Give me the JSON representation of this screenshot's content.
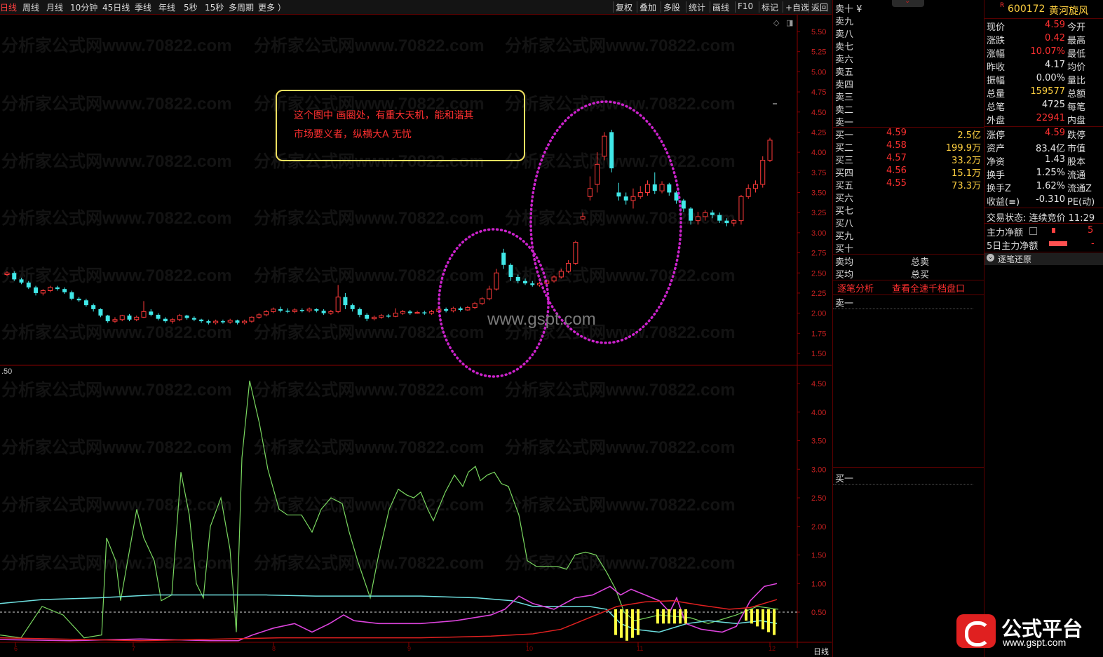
{
  "toolbar": {
    "periods": [
      "日线",
      "周线",
      "月线",
      "10分钟",
      "45日线",
      "季线",
      "年线",
      "5秒",
      "15秒",
      "多周期",
      "更多 ）"
    ],
    "tools": [
      "复权",
      "叠加",
      "多股",
      "统计",
      "画线",
      "F10",
      "标记",
      "+自选",
      "返回"
    ]
  },
  "main_axis": [
    "5.50",
    "5.25",
    "5.00",
    "4.75",
    "4.50",
    "4.25",
    "4.00",
    "3.75",
    "3.50",
    "3.25",
    "3.00",
    "2.75",
    "2.50",
    "2.25",
    "2.00",
    "1.75",
    "1.50"
  ],
  "sub_axis": [
    "4.50",
    "4.00",
    "3.50",
    "3.00",
    "2.50",
    "2.00",
    "1.50",
    "1.00",
    "0.50"
  ],
  "sub_left_label": ".50",
  "date_marks": [
    "6",
    "7",
    "8",
    "9",
    "10",
    "11",
    "12"
  ],
  "bottom_label": "日线",
  "annotation": {
    "line1": "这个图中 画圈处，有重大天机，能和谐其",
    "line2": "市场要义者，纵横大A 无忧"
  },
  "center_watermark": "www.gspt.com",
  "watermark_text": "分析家公式网www.70822.com",
  "colors": {
    "up": "#ff3a3a",
    "down": "#40e8e8",
    "frame": "#8a0000",
    "circle": "#cc22cc"
  },
  "chart_data": {
    "type": "candlestick",
    "ylim": [
      1.4,
      5.6
    ],
    "candles": [
      [
        2.48,
        2.5,
        2.52,
        2.46
      ],
      [
        2.5,
        2.42,
        2.52,
        2.4
      ],
      [
        2.42,
        2.38,
        2.44,
        2.36
      ],
      [
        2.38,
        2.32,
        2.4,
        2.3
      ],
      [
        2.32,
        2.25,
        2.34,
        2.22
      ],
      [
        2.25,
        2.28,
        2.3,
        2.22
      ],
      [
        2.28,
        2.32,
        2.34,
        2.26
      ],
      [
        2.32,
        2.3,
        2.34,
        2.28
      ],
      [
        2.3,
        2.26,
        2.32,
        2.24
      ],
      [
        2.26,
        2.18,
        2.28,
        2.16
      ],
      [
        2.18,
        2.16,
        2.2,
        2.14
      ],
      [
        2.16,
        2.1,
        2.18,
        2.08
      ],
      [
        2.1,
        2.05,
        2.12,
        2.02
      ],
      [
        2.05,
        1.97,
        2.06,
        1.95
      ],
      [
        1.97,
        1.9,
        1.98,
        1.88
      ],
      [
        1.9,
        1.92,
        1.95,
        1.88
      ],
      [
        1.92,
        1.97,
        1.98,
        1.9
      ],
      [
        1.97,
        1.92,
        1.99,
        1.9
      ],
      [
        1.92,
        1.95,
        1.97,
        1.9
      ],
      [
        1.95,
        2.02,
        2.15,
        1.94
      ],
      [
        2.02,
        1.98,
        2.05,
        1.96
      ],
      [
        1.98,
        1.93,
        2.0,
        1.91
      ],
      [
        1.93,
        1.9,
        1.95,
        1.88
      ],
      [
        1.9,
        1.92,
        1.94,
        1.87
      ],
      [
        1.92,
        1.97,
        1.99,
        1.9
      ],
      [
        1.97,
        1.94,
        1.98,
        1.92
      ],
      [
        1.94,
        1.92,
        1.96,
        1.9
      ],
      [
        1.92,
        1.9,
        1.93,
        1.88
      ],
      [
        1.9,
        1.88,
        1.92,
        1.86
      ],
      [
        1.88,
        1.9,
        1.92,
        1.86
      ],
      [
        1.9,
        1.89,
        1.92,
        1.87
      ],
      [
        1.89,
        1.91,
        1.93,
        1.87
      ],
      [
        1.91,
        1.88,
        1.92,
        1.86
      ],
      [
        1.88,
        1.9,
        1.92,
        1.86
      ],
      [
        1.9,
        1.95,
        1.96,
        1.88
      ],
      [
        1.95,
        1.98,
        2.0,
        1.93
      ],
      [
        1.98,
        2.02,
        2.04,
        1.96
      ],
      [
        2.02,
        2.05,
        2.07,
        2.0
      ],
      [
        2.05,
        2.03,
        2.08,
        2.01
      ],
      [
        2.03,
        2.02,
        2.06,
        2.0
      ],
      [
        2.02,
        2.04,
        2.06,
        2.0
      ],
      [
        2.04,
        2.03,
        2.06,
        2.01
      ],
      [
        2.03,
        2.05,
        2.07,
        2.01
      ],
      [
        2.05,
        2.03,
        2.06,
        2.01
      ],
      [
        2.03,
        2.0,
        2.05,
        1.98
      ],
      [
        2.0,
        2.02,
        2.04,
        1.98
      ],
      [
        2.02,
        2.2,
        2.35,
        2.0
      ],
      [
        2.2,
        2.1,
        2.25,
        2.05
      ],
      [
        2.1,
        2.05,
        2.12,
        2.02
      ],
      [
        2.05,
        1.98,
        2.07,
        1.95
      ],
      [
        1.98,
        1.93,
        2.0,
        1.9
      ],
      [
        1.93,
        1.95,
        1.97,
        1.91
      ],
      [
        1.95,
        1.97,
        1.99,
        1.93
      ],
      [
        1.97,
        1.96,
        1.99,
        1.94
      ],
      [
        1.96,
        2.0,
        2.06,
        1.95
      ],
      [
        2.0,
        2.02,
        2.04,
        1.98
      ],
      [
        2.02,
        2.0,
        2.04,
        1.98
      ],
      [
        2.0,
        2.01,
        2.03,
        1.99
      ],
      [
        2.01,
        2.0,
        2.03,
        1.98
      ],
      [
        2.0,
        2.02,
        2.04,
        1.98
      ],
      [
        2.02,
        2.05,
        2.07,
        2.0
      ],
      [
        2.05,
        2.03,
        2.07,
        2.01
      ],
      [
        2.03,
        2.06,
        2.08,
        2.01
      ],
      [
        2.06,
        2.04,
        2.08,
        2.02
      ],
      [
        2.04,
        2.07,
        2.09,
        2.03
      ],
      [
        2.07,
        2.12,
        2.14,
        2.05
      ],
      [
        2.12,
        2.18,
        2.2,
        2.1
      ],
      [
        2.18,
        2.3,
        2.34,
        2.16
      ],
      [
        2.3,
        2.5,
        2.55,
        2.28
      ],
      [
        2.75,
        2.6,
        2.8,
        2.55
      ],
      [
        2.6,
        2.45,
        2.62,
        2.4
      ],
      [
        2.45,
        2.4,
        2.48,
        2.37
      ],
      [
        2.4,
        2.37,
        2.43,
        2.35
      ],
      [
        2.37,
        2.35,
        2.4,
        2.33
      ],
      [
        2.35,
        2.37,
        2.39,
        2.33
      ],
      [
        2.37,
        2.4,
        2.42,
        2.35
      ],
      [
        2.4,
        2.45,
        2.47,
        2.38
      ],
      [
        2.45,
        2.52,
        2.55,
        2.43
      ],
      [
        2.52,
        2.62,
        2.66,
        2.5
      ],
      [
        2.62,
        2.88,
        2.9,
        2.6
      ],
      [
        3.17,
        3.2,
        3.25,
        3.16
      ],
      [
        3.45,
        3.55,
        3.7,
        3.4
      ],
      [
        3.6,
        3.85,
        4.0,
        3.5
      ],
      [
        3.95,
        4.2,
        4.25,
        3.9
      ],
      [
        4.25,
        3.8,
        4.28,
        3.75
      ],
      [
        3.5,
        3.45,
        3.62,
        3.4
      ],
      [
        3.45,
        3.4,
        3.5,
        3.35
      ],
      [
        3.4,
        3.45,
        3.55,
        3.3
      ],
      [
        3.45,
        3.5,
        3.58,
        3.42
      ],
      [
        3.5,
        3.6,
        3.65,
        3.46
      ],
      [
        3.6,
        3.52,
        3.75,
        3.48
      ],
      [
        3.52,
        3.6,
        3.64,
        3.49
      ],
      [
        3.6,
        3.5,
        3.62,
        3.46
      ],
      [
        3.5,
        3.4,
        3.52,
        3.36
      ],
      [
        3.4,
        3.3,
        3.42,
        3.26
      ],
      [
        3.3,
        3.15,
        3.32,
        3.1
      ],
      [
        3.15,
        3.2,
        3.26,
        3.1
      ],
      [
        3.2,
        3.25,
        3.28,
        3.15
      ],
      [
        3.25,
        3.22,
        3.28,
        3.18
      ],
      [
        3.22,
        3.15,
        3.25,
        3.12
      ],
      [
        3.15,
        3.12,
        3.18,
        3.08
      ],
      [
        3.12,
        3.15,
        3.17,
        3.08
      ],
      [
        3.15,
        3.45,
        3.47,
        3.1
      ],
      [
        3.45,
        3.55,
        3.6,
        3.42
      ],
      [
        3.55,
        3.6,
        3.65,
        3.5
      ],
      [
        3.6,
        3.9,
        3.95,
        3.56
      ],
      [
        3.9,
        4.15,
        4.18,
        3.88
      ]
    ]
  },
  "order_book": {
    "sells": [
      "卖十 ¥",
      "卖九",
      "卖八",
      "卖七",
      "卖六",
      "卖五",
      "卖四",
      "卖三",
      "卖二",
      "卖一"
    ],
    "buys": [
      {
        "label": "买一",
        "price": "4.59",
        "vol": "2.5亿"
      },
      {
        "label": "买二",
        "price": "4.58",
        "vol": "199.9万"
      },
      {
        "label": "买三",
        "price": "4.57",
        "vol": "33.2万"
      },
      {
        "label": "买四",
        "price": "4.56",
        "vol": "15.1万"
      },
      {
        "label": "买五",
        "price": "4.55",
        "vol": "73.3万"
      },
      {
        "label": "买六",
        "price": "",
        "vol": ""
      },
      {
        "label": "买七",
        "price": "",
        "vol": ""
      },
      {
        "label": "买八",
        "price": "",
        "vol": ""
      },
      {
        "label": "买九",
        "price": "",
        "vol": ""
      },
      {
        "label": "买十",
        "price": "",
        "vol": ""
      }
    ],
    "sell_avg": "卖均",
    "sell_total": "总卖",
    "buy_avg": "买均",
    "buy_total": "总买",
    "link_tick": "逐笔分析",
    "link_full": "查看全速千档盘口",
    "sell1_label": "卖一",
    "buy1_label": "买一"
  },
  "stock": {
    "badge": "R",
    "code": "600172",
    "name": "黄河旋风",
    "quotes": [
      {
        "label": "现价",
        "value": "4.59",
        "cls": "red",
        "right": "今开"
      },
      {
        "label": "涨跌",
        "value": "0.42",
        "cls": "red",
        "right": "最高"
      },
      {
        "label": "涨幅",
        "value": "10.07%",
        "cls": "red",
        "right": "最低"
      },
      {
        "label": "昨收",
        "value": "4.17",
        "cls": "white",
        "right": "均价"
      },
      {
        "label": "振幅",
        "value": "0.00%",
        "cls": "white",
        "right": "量比"
      },
      {
        "label": "总量",
        "value": "159577",
        "cls": "gold",
        "right": "总额"
      },
      {
        "label": "总笔",
        "value": "4725",
        "cls": "white",
        "right": "每笔"
      },
      {
        "label": "外盘",
        "value": "22941",
        "cls": "red",
        "right": "内盘"
      },
      {
        "label": "涨停",
        "value": "4.59",
        "cls": "red",
        "right": "跌停"
      },
      {
        "label": "资产",
        "value": "83.4亿",
        "cls": "white",
        "right": "市值"
      },
      {
        "label": "净资",
        "value": "1.43",
        "cls": "white",
        "right": "股本"
      },
      {
        "label": "换手",
        "value": "1.25%",
        "cls": "white",
        "right": "流通"
      },
      {
        "label": "换手Z",
        "value": "1.62%",
        "cls": "white",
        "right": "流通Z"
      },
      {
        "label": "收益(≡)",
        "value": "-0.310",
        "cls": "white",
        "right": "PE(动)"
      }
    ],
    "status": "交易状态: 连续竞价 11:29",
    "main_flow_label": "主力净额",
    "main_flow_val": "5",
    "flow5_label": "5日主力净额",
    "flow5_val": "-",
    "restore": "逐笔还原"
  },
  "logo": {
    "text": "公式平台",
    "sub": "www.gspt.com"
  }
}
